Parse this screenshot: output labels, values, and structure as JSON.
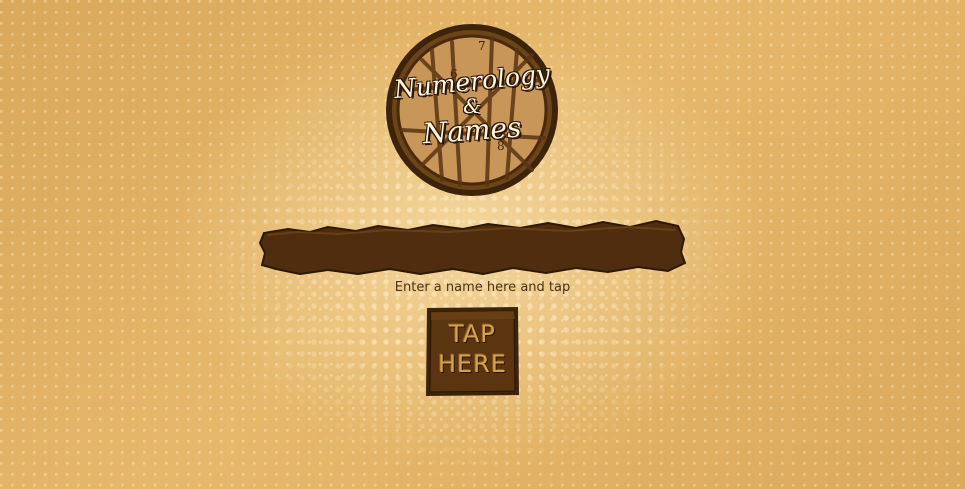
{
  "logo": {
    "line1": "Numerology",
    "line2": "&",
    "line3": "Names"
  },
  "name_input": {
    "value": "",
    "placeholder": ""
  },
  "hint_text": "Enter a name here and tap",
  "tap_button": {
    "line1": "TAP",
    "line2": "HERE"
  },
  "colors": {
    "background": "#e0b064",
    "dark_brown": "#4a2a0c",
    "tan": "#c9965a"
  }
}
